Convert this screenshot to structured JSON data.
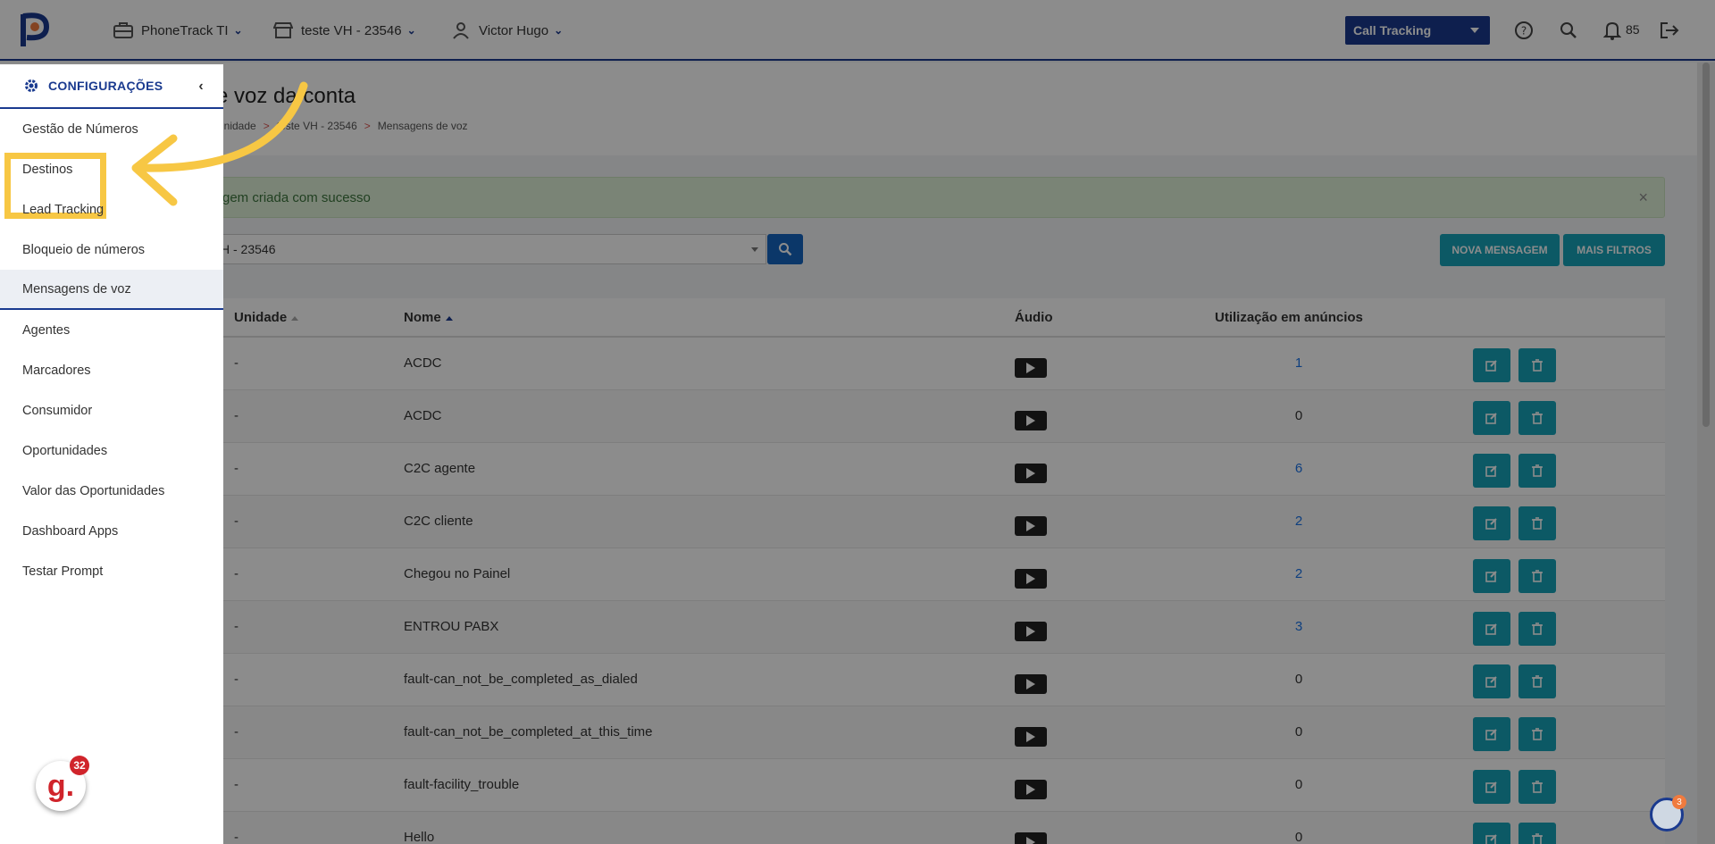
{
  "topbar": {
    "company": "PhoneTrack TI",
    "unit": "teste VH - 23546",
    "user": "Victor Hugo",
    "product_select": "Call Tracking",
    "notifications": "85"
  },
  "header": {
    "title": "e voz da conta",
    "breadcrumb": [
      "Unidade",
      "teste VH - 23546",
      "Mensagens de voz"
    ]
  },
  "alert": {
    "message": "gem criada com sucesso",
    "close": "×"
  },
  "filters": {
    "unit_value": "H - 23546",
    "new_message": "NOVA MENSAGEM",
    "more_filters": "MAIS FILTROS"
  },
  "table": {
    "columns": {
      "unit": "Unidade",
      "name": "Nome",
      "audio": "Áudio",
      "usage": "Utilização em anúncios"
    },
    "rows": [
      {
        "unit": "-",
        "name": "ACDC",
        "usage": "1",
        "link": true
      },
      {
        "unit": "-",
        "name": "ACDC",
        "usage": "0",
        "link": false
      },
      {
        "unit": "-",
        "name": "C2C agente",
        "usage": "6",
        "link": true
      },
      {
        "unit": "-",
        "name": "C2C cliente",
        "usage": "2",
        "link": true
      },
      {
        "unit": "-",
        "name": "Chegou no Painel",
        "usage": "2",
        "link": true
      },
      {
        "unit": "-",
        "name": "ENTROU PABX",
        "usage": "3",
        "link": true
      },
      {
        "unit": "-",
        "name": "fault-can_not_be_completed_as_dialed",
        "usage": "0",
        "link": false
      },
      {
        "unit": "-",
        "name": "fault-can_not_be_completed_at_this_time",
        "usage": "0",
        "link": false
      },
      {
        "unit": "-",
        "name": "fault-facility_trouble",
        "usage": "0",
        "link": false
      },
      {
        "unit": "-",
        "name": "Hello",
        "usage": "0",
        "link": false
      }
    ]
  },
  "sidebar": {
    "title": "CONFIGURAÇÕES",
    "items": [
      {
        "label": "Gestão de Números"
      },
      {
        "label": "Destinos"
      },
      {
        "label": "Lead Tracking"
      },
      {
        "label": "Bloqueio de números"
      },
      {
        "label": "Mensagens de voz"
      },
      {
        "label": "Agentes"
      },
      {
        "label": "Marcadores"
      },
      {
        "label": "Consumidor"
      },
      {
        "label": "Oportunidades"
      },
      {
        "label": "Valor das Oportunidades"
      },
      {
        "label": "Dashboard Apps"
      },
      {
        "label": "Testar Prompt"
      }
    ]
  },
  "floating": {
    "chat_letter": "g.",
    "chat_count": "32",
    "help_count": "3"
  },
  "colors": {
    "brand": "#1a3a8f",
    "teal": "#17a2b8",
    "highlight": "#f7c744"
  }
}
